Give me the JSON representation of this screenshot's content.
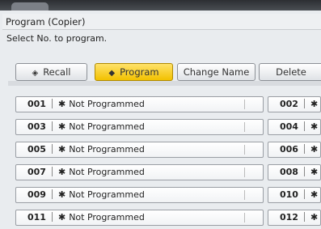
{
  "window": {
    "title": "Program (Copier)"
  },
  "instruction": "Select No. to program.",
  "toolbar": {
    "recall_label": "Recall",
    "program_label": "Program",
    "change_name_label": "Change Name",
    "delete_label": "Delete"
  },
  "program_slots": {
    "star": "✱",
    "left": [
      {
        "number": "001",
        "status": "Not Programmed"
      },
      {
        "number": "003",
        "status": "Not Programmed"
      },
      {
        "number": "005",
        "status": "Not Programmed"
      },
      {
        "number": "007",
        "status": "Not Programmed"
      },
      {
        "number": "009",
        "status": "Not Programmed"
      },
      {
        "number": "011",
        "status": "Not Programmed"
      }
    ],
    "right": [
      {
        "number": "002"
      },
      {
        "number": "004"
      },
      {
        "number": "006"
      },
      {
        "number": "008"
      },
      {
        "number": "010"
      },
      {
        "number": "012"
      }
    ]
  },
  "colors": {
    "accent": "#f2c100",
    "panel": "#e9ecef",
    "header": "#2c2f33"
  }
}
